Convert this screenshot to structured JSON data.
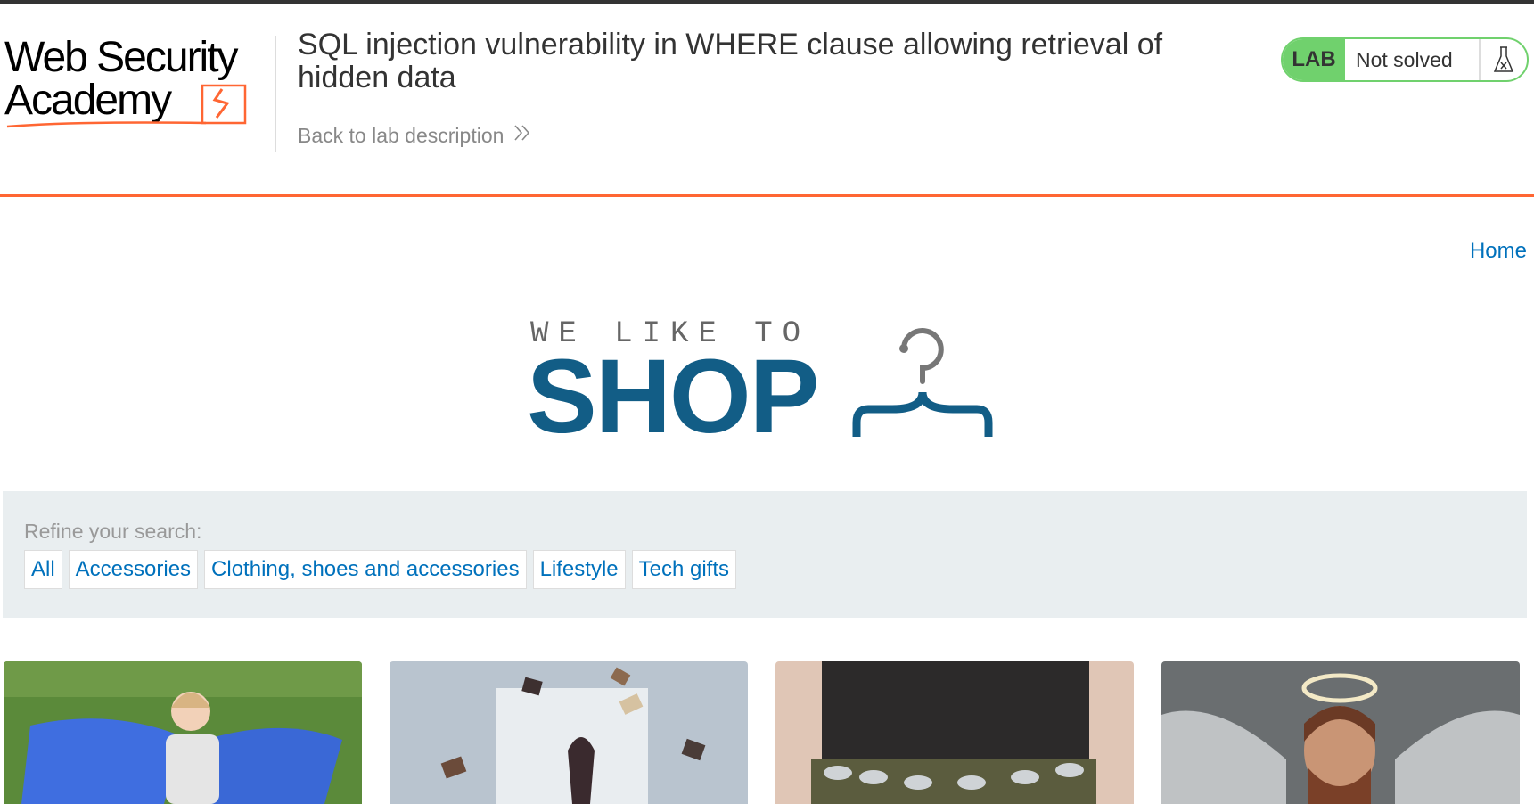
{
  "academy": {
    "logo_line1": "Web Security",
    "logo_line2": "Academy"
  },
  "lab": {
    "title": "SQL injection vulnerability in WHERE clause allowing retrieval of hidden data",
    "back_label": "Back to lab description",
    "tag": "LAB",
    "status": "Not solved",
    "colors": {
      "badge": "#70d16d",
      "accent": "#ff6633"
    }
  },
  "nav": {
    "home": "Home"
  },
  "banner": {
    "top": "WE LIKE TO",
    "main": "SHOP",
    "color": "#125d86"
  },
  "filters": {
    "label": "Refine your search:",
    "items": [
      "All",
      "Accessories",
      "Clothing, shoes and accessories",
      "Lifestyle",
      "Tech gifts"
    ]
  },
  "products": [
    {
      "image": "inflatable-chair-girl"
    },
    {
      "image": "floating-books"
    },
    {
      "image": "beer-can-belt"
    },
    {
      "image": "angel-man-with-halo"
    }
  ]
}
